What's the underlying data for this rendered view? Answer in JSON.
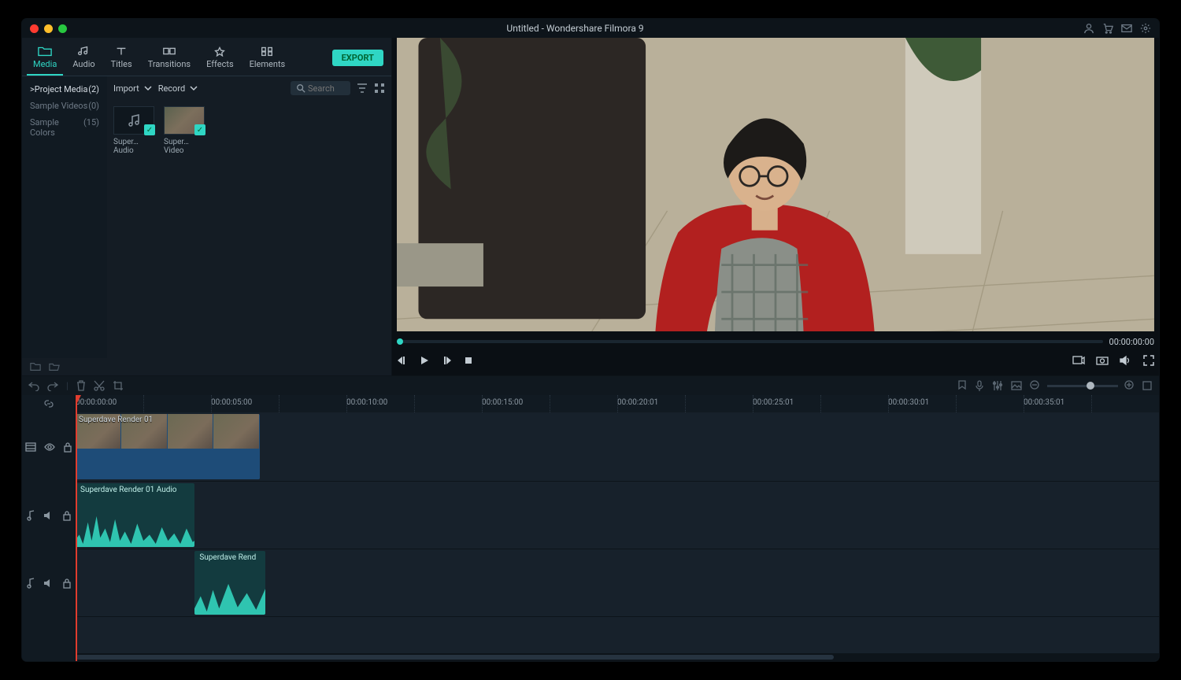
{
  "titlebar": {
    "title": "Untitled - Wondershare Filmora 9",
    "right_icons": [
      "user-icon",
      "cart-icon",
      "mail-icon",
      "settings-icon"
    ]
  },
  "tabs": {
    "items": [
      {
        "label": "Media",
        "icon": "folder-icon",
        "active": true
      },
      {
        "label": "Audio",
        "icon": "audio-icon"
      },
      {
        "label": "Titles",
        "icon": "titles-icon"
      },
      {
        "label": "Transitions",
        "icon": "transitions-icon"
      },
      {
        "label": "Effects",
        "icon": "effects-icon"
      },
      {
        "label": "Elements",
        "icon": "elements-icon"
      }
    ],
    "export_label": "EXPORT"
  },
  "sidebar": {
    "items": [
      {
        "label": "Project Media",
        "count": "(2)",
        "active": true,
        "prefix": ">"
      },
      {
        "label": "Sample Videos",
        "count": "(0)"
      },
      {
        "label": "Sample Colors",
        "count": "(15)"
      }
    ]
  },
  "mediabar": {
    "import_label": "Import",
    "record_label": "Record",
    "search_placeholder": "Search",
    "tool_icons": [
      "filter-icon",
      "grid-icon"
    ]
  },
  "media_items": [
    {
      "label": "Super…Audio",
      "type": "audio"
    },
    {
      "label": "Super…Video",
      "type": "video"
    }
  ],
  "preview": {
    "time": "00:00:00:00",
    "controls": [
      "step-back-icon",
      "play-icon",
      "step-forward-icon",
      "stop-icon"
    ],
    "right_controls": [
      "record-screen-icon",
      "snapshot-icon",
      "volume-icon",
      "fullscreen-icon"
    ]
  },
  "timeline_tools": {
    "left": [
      "undo-icon",
      "redo-icon",
      "delete-icon",
      "cut-icon",
      "crop-icon"
    ],
    "right": [
      "marker-icon",
      "mic-icon",
      "audio-mixer-icon",
      "photo-icon",
      "zoom-in-icon",
      "zoom-fit-icon"
    ],
    "gutter_head": "link-icon"
  },
  "ruler": {
    "labels": [
      "00:00:00:00",
      "00:00:05:00",
      "00:00:10:00",
      "00:00:15:00",
      "00:00:20:01",
      "00:00:25:01",
      "00:00:30:01",
      "00:00:35:01"
    ]
  },
  "tracks": {
    "video": {
      "clip_label": "Superdave Render 01",
      "start_pct": 0,
      "width_pct": 17
    },
    "audio1": {
      "clip_label": "Superdave Render 01 Audio",
      "start_pct": 0,
      "width_pct": 11
    },
    "audio2": {
      "clip_label": "Superdave Rend",
      "start_pct": 11,
      "width_pct": 6.5
    }
  },
  "colors": {
    "accent": "#2fd6c4",
    "teal": "#2fc4b0",
    "blue": "#1e4c78"
  }
}
